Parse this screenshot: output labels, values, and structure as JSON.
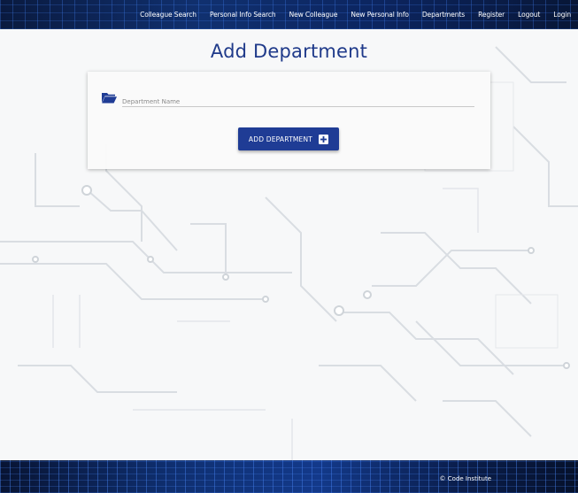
{
  "nav": {
    "items": [
      {
        "label": "Colleague Search"
      },
      {
        "label": "Personal Info Search"
      },
      {
        "label": "New Colleague"
      },
      {
        "label": "New Personal Info"
      },
      {
        "label": "Departments"
      },
      {
        "label": "Register"
      },
      {
        "label": "Logout"
      },
      {
        "label": "Login"
      }
    ]
  },
  "page": {
    "title": "Add Department"
  },
  "form": {
    "field_icon": "folder-open-icon",
    "department_name_placeholder": "Department Name",
    "department_name_value": "",
    "submit_label": "ADD DEPARTMENT",
    "submit_icon": "plus-square-icon"
  },
  "footer": {
    "copyright_symbol": "©",
    "text": "Code Institute"
  },
  "colors": {
    "brand": "#1f3c95",
    "title": "#1f3a8a",
    "nav_bg": "#0c2560"
  }
}
